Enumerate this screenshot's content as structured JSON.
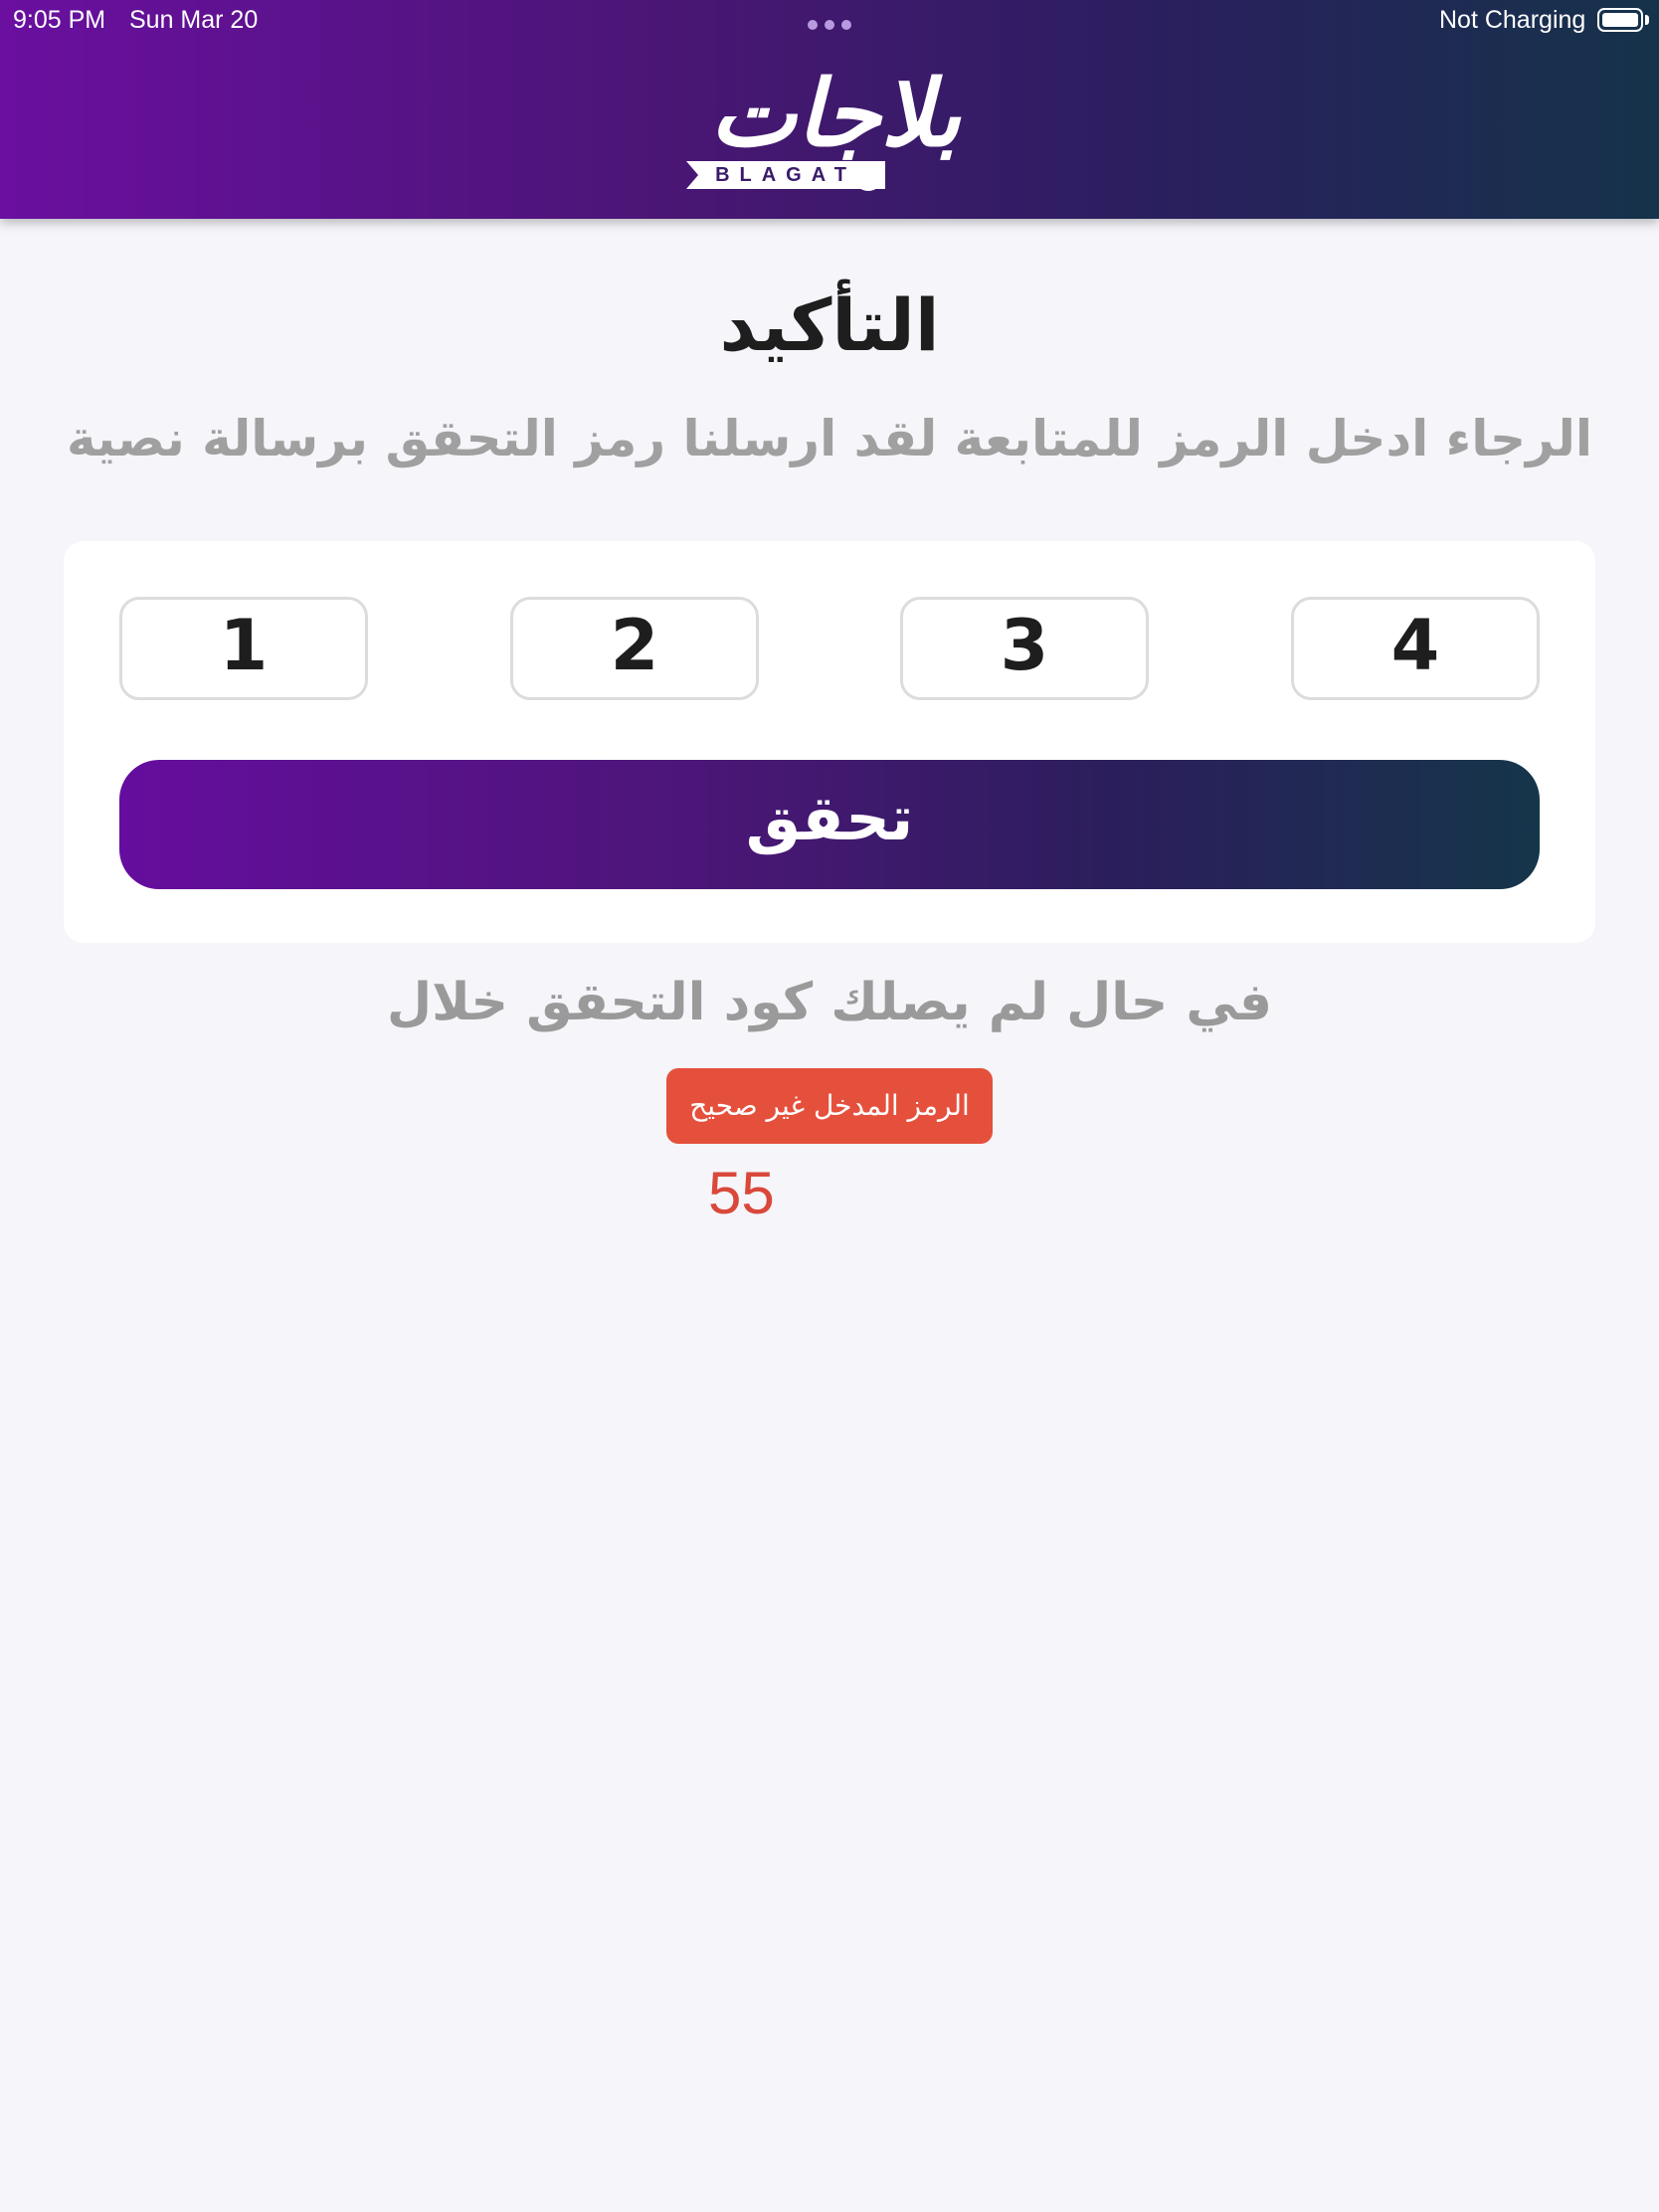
{
  "status_bar": {
    "time": "9:05 PM",
    "date": "Sun Mar 20",
    "charging": "Not Charging"
  },
  "header": {
    "logo_arabic": "بلاجات",
    "logo_latin": "BLAGAT"
  },
  "title": "التأكيد",
  "subtitle": "الرجاء ادخل الرمز للمتابعة لقد ارسلنا رمز التحقق برسالة نصية",
  "otp": [
    "1",
    "2",
    "3",
    "4"
  ],
  "verify_button": "تحقق",
  "resend_text": "في حال لم يصلك كود التحقق خلال",
  "toast": "الرمز المدخل غير صحيح",
  "countdown": "55",
  "colors": {
    "header_start": "#6a0fa0",
    "header_end": "#15334a",
    "toast": "#e5503c",
    "countdown": "#d9483a"
  }
}
